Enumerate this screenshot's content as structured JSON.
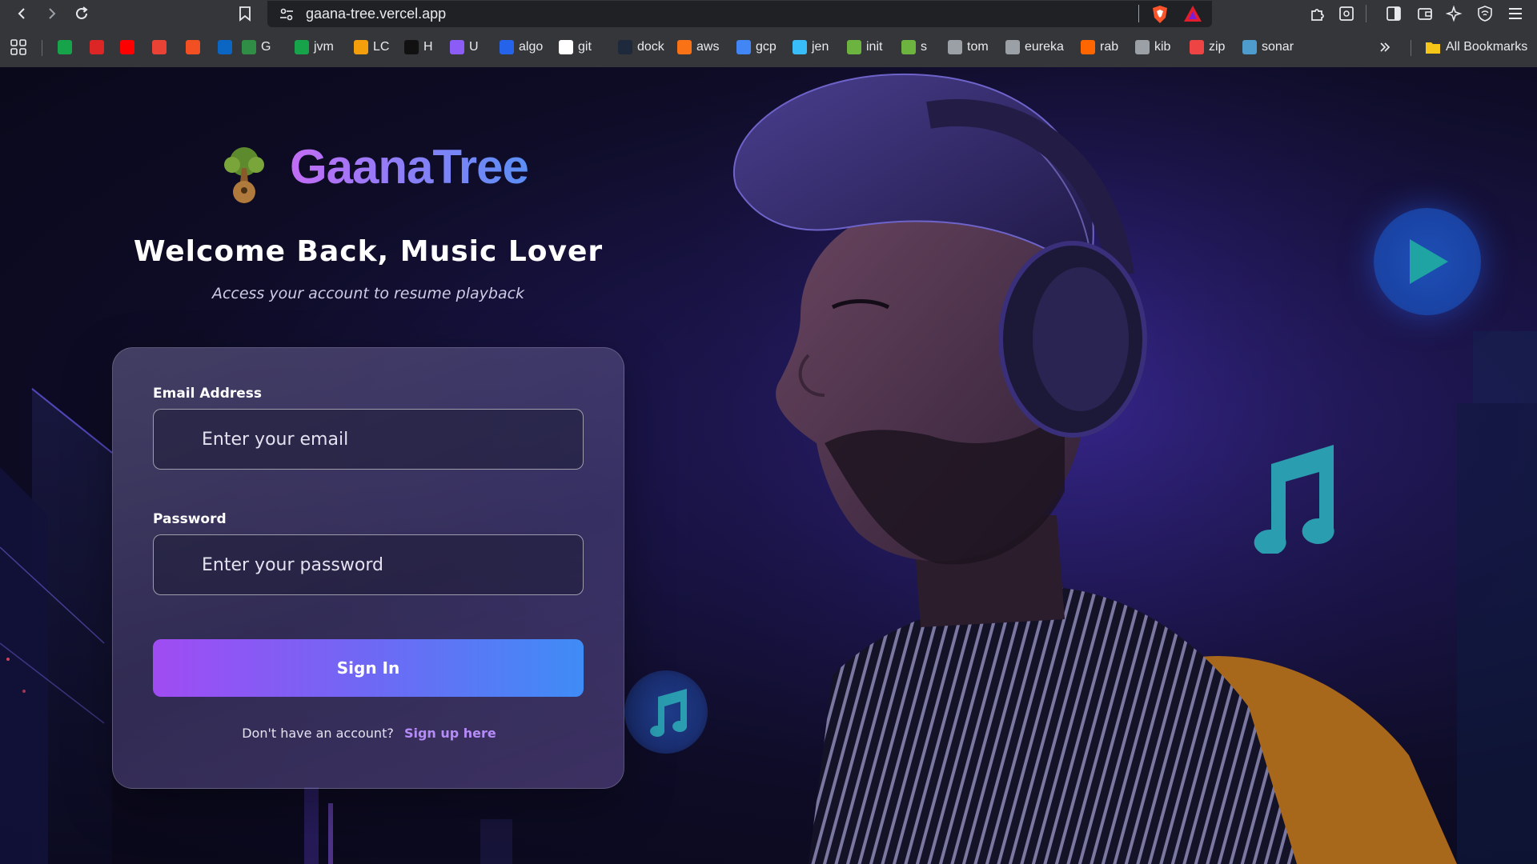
{
  "browser": {
    "url": "gaana-tree.vercel.app",
    "bookmarks": [
      {
        "label": "",
        "icon": "cb-icon",
        "color": "#16a34a"
      },
      {
        "label": "",
        "icon": "diamond-icon",
        "color": "#dc2626"
      },
      {
        "label": "",
        "icon": "youtube-icon",
        "color": "#ff0000"
      },
      {
        "label": "",
        "icon": "gmail-icon",
        "color": "#ea4335"
      },
      {
        "label": "",
        "icon": "microsoft-icon",
        "color": "#f25022"
      },
      {
        "label": "",
        "icon": "linkedin-icon",
        "color": "#0a66c2"
      },
      {
        "label": "G",
        "icon": "geeks-icon",
        "color": "#2f8d46"
      },
      {
        "label": "jvm",
        "icon": "jvm-icon",
        "color": "#16a34a"
      },
      {
        "label": "LC",
        "icon": "leetcode-icon",
        "color": "#f59e0b"
      },
      {
        "label": "H",
        "icon": "hackerrank-icon",
        "color": "#111111"
      },
      {
        "label": "U",
        "icon": "udemy-icon",
        "color": "#8b5cf6"
      },
      {
        "label": "algo",
        "icon": "algo-icon",
        "color": "#2563eb"
      },
      {
        "label": "git",
        "icon": "github-icon",
        "color": "#ffffff"
      },
      {
        "label": "dock",
        "icon": "docker-icon",
        "color": "#1e293b"
      },
      {
        "label": "aws",
        "icon": "aws-icon",
        "color": "#f97316"
      },
      {
        "label": "gcp",
        "icon": "google-icon",
        "color": "#4285f4"
      },
      {
        "label": "jen",
        "icon": "jenkins-icon",
        "color": "#38bdf8"
      },
      {
        "label": "init",
        "icon": "spring-icon",
        "color": "#6db33f"
      },
      {
        "label": "s",
        "icon": "spring-icon",
        "color": "#6db33f"
      },
      {
        "label": "tom",
        "icon": "globe-icon",
        "color": "#9aa0a6"
      },
      {
        "label": "eureka",
        "icon": "globe-icon",
        "color": "#9aa0a6"
      },
      {
        "label": "rab",
        "icon": "rabbitmq-icon",
        "color": "#ff6600"
      },
      {
        "label": "kib",
        "icon": "kibana-icon",
        "color": "#9aa0a6"
      },
      {
        "label": "zip",
        "icon": "zipkin-icon",
        "color": "#ef4444"
      },
      {
        "label": "sonar",
        "icon": "sonar-icon",
        "color": "#4e9bcd"
      }
    ],
    "all_bookmarks": "All Bookmarks"
  },
  "brand": {
    "name": "GaanaTree"
  },
  "login": {
    "title": "Welcome Back, Music Lover",
    "subtitle": "Access your account to resume playback",
    "email_label": "Email Address",
    "email_placeholder": "Enter your email",
    "password_label": "Password",
    "password_placeholder": "Enter your password",
    "signin_label": "Sign In",
    "signup_prompt": "Don't have an account?",
    "signup_link": "Sign up here"
  },
  "colors": {
    "accent_start": "#a04cf3",
    "accent_end": "#3f8cf6",
    "note_teal": "#2a9db0",
    "page_bg": "#0e0c26"
  }
}
